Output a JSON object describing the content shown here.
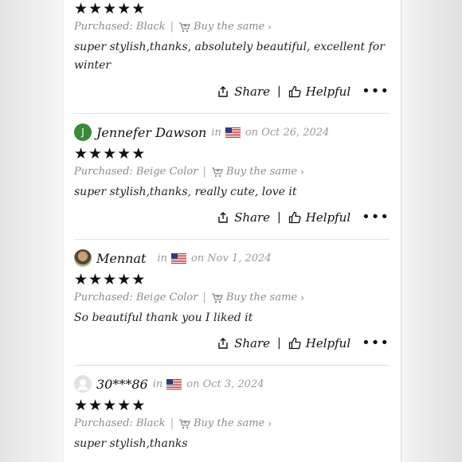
{
  "reviews": [
    {
      "rating": 5,
      "purchased": "Purchased: Black",
      "buy_same": "Buy the same",
      "text": "super stylish,thanks, absolutely beautiful, excellent for winter",
      "share": "Share",
      "helpful": "Helpful"
    },
    {
      "avatar_initial": "J",
      "name": "Jennefer Dawson",
      "in_label": "in",
      "flag": "us-flag-icon",
      "date": "on Oct 26, 2024",
      "rating": 5,
      "purchased": "Purchased: Beige Color",
      "buy_same": "Buy the same",
      "text": "super stylish,thanks, really cute, love it",
      "share": "Share",
      "helpful": "Helpful"
    },
    {
      "name": "Mennat",
      "in_label": "in",
      "flag": "us-flag-icon",
      "date": "on Nov 1, 2024",
      "rating": 5,
      "purchased": "Purchased: Beige Color",
      "buy_same": "Buy the same",
      "text": "So beautiful thank you I liked it",
      "share": "Share",
      "helpful": "Helpful"
    },
    {
      "name": "30***86",
      "in_label": "in",
      "flag": "us-flag-icon",
      "date": "on Oct 3, 2024",
      "rating": 5,
      "purchased": "Purchased: Black",
      "buy_same": "Buy the same",
      "text": "super stylish,thanks"
    }
  ],
  "colors": {
    "text": "#111111",
    "muted": "#8c8c8c",
    "divider": "#e3e3e3",
    "avatar_green": "#3a8a3a"
  }
}
